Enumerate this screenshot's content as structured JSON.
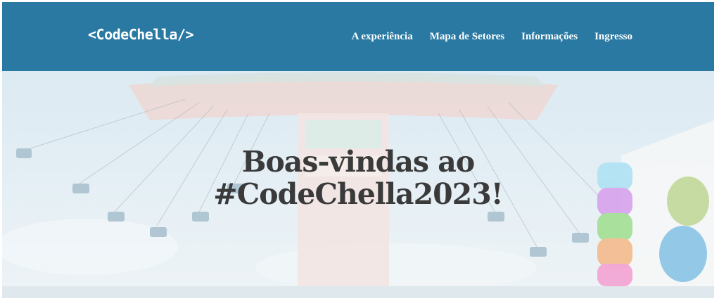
{
  "header": {
    "logo": "<CodeChella/>",
    "nav": [
      {
        "label": "A experiência"
      },
      {
        "label": "Mapa de Setores"
      },
      {
        "label": "Informações"
      },
      {
        "label": "Ingresso"
      }
    ]
  },
  "hero": {
    "title_line1": "Boas-vindas ao",
    "title_line2": "#CodeChella2023!"
  },
  "colors": {
    "header_bg": "#2a79a3",
    "title_text": "#3a3a3a"
  }
}
